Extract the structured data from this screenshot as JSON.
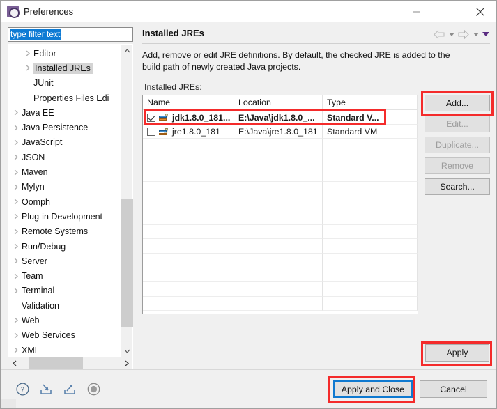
{
  "window": {
    "title": "Preferences",
    "icon": "preferences-gear-icon",
    "controls": {
      "minimize": "minimize-icon",
      "maximize": "maximize-icon",
      "close": "close-icon"
    }
  },
  "filter": {
    "value": "type filter text",
    "placeholder": "type filter text"
  },
  "tree": {
    "items": [
      {
        "label": "Editor",
        "depth": 1,
        "expandable": true,
        "selected": false
      },
      {
        "label": "Installed JREs",
        "depth": 1,
        "expandable": true,
        "selected": true
      },
      {
        "label": "JUnit",
        "depth": 1,
        "expandable": false,
        "selected": false
      },
      {
        "label": "Properties Files Edi",
        "depth": 1,
        "expandable": false,
        "selected": false
      },
      {
        "label": "Java EE",
        "depth": 0,
        "expandable": true,
        "selected": false
      },
      {
        "label": "Java Persistence",
        "depth": 0,
        "expandable": true,
        "selected": false
      },
      {
        "label": "JavaScript",
        "depth": 0,
        "expandable": true,
        "selected": false
      },
      {
        "label": "JSON",
        "depth": 0,
        "expandable": true,
        "selected": false
      },
      {
        "label": "Maven",
        "depth": 0,
        "expandable": true,
        "selected": false
      },
      {
        "label": "Mylyn",
        "depth": 0,
        "expandable": true,
        "selected": false
      },
      {
        "label": "Oomph",
        "depth": 0,
        "expandable": true,
        "selected": false
      },
      {
        "label": "Plug-in Development",
        "depth": 0,
        "expandable": true,
        "selected": false
      },
      {
        "label": "Remote Systems",
        "depth": 0,
        "expandable": true,
        "selected": false
      },
      {
        "label": "Run/Debug",
        "depth": 0,
        "expandable": true,
        "selected": false
      },
      {
        "label": "Server",
        "depth": 0,
        "expandable": true,
        "selected": false
      },
      {
        "label": "Team",
        "depth": 0,
        "expandable": true,
        "selected": false
      },
      {
        "label": "Terminal",
        "depth": 0,
        "expandable": true,
        "selected": false
      },
      {
        "label": "Validation",
        "depth": 0,
        "expandable": false,
        "selected": false
      },
      {
        "label": "Web",
        "depth": 0,
        "expandable": true,
        "selected": false
      },
      {
        "label": "Web Services",
        "depth": 0,
        "expandable": true,
        "selected": false
      },
      {
        "label": "XML",
        "depth": 0,
        "expandable": true,
        "selected": false
      }
    ]
  },
  "page": {
    "title": "Installed JREs",
    "description": "Add, remove or edit JRE definitions. By default, the checked JRE is added to the build path of newly created Java projects.",
    "table_label": "Installed JREs:",
    "nav": {
      "back": "back-arrow-icon",
      "back_menu": "back-dropdown-icon",
      "forward": "forward-arrow-icon",
      "forward_menu": "forward-dropdown-icon",
      "view_menu": "view-menu-icon"
    }
  },
  "table": {
    "columns": [
      "Name",
      "Location",
      "Type"
    ],
    "rows": [
      {
        "checked": true,
        "selected": true,
        "name": "jdk1.8.0_181...",
        "location": "E:\\Java\\jdk1.8.0_...",
        "type": "Standard V..."
      },
      {
        "checked": false,
        "selected": false,
        "name": "jre1.8.0_181",
        "location": "E:\\Java\\jre1.8.0_181",
        "type": "Standard VM"
      }
    ],
    "empty_row_count": 12
  },
  "side_buttons": [
    {
      "label": "Add...",
      "enabled": true,
      "highlighted": true
    },
    {
      "label": "Edit...",
      "enabled": false,
      "highlighted": false
    },
    {
      "label": "Duplicate...",
      "enabled": false,
      "highlighted": false
    },
    {
      "label": "Remove",
      "enabled": false,
      "highlighted": false
    },
    {
      "label": "Search...",
      "enabled": true,
      "highlighted": false
    }
  ],
  "apply_button": {
    "label": "Apply",
    "highlighted": true
  },
  "bottom": {
    "icons": [
      "help-icon",
      "import-icon",
      "export-icon",
      "record-icon"
    ],
    "apply_and_close": {
      "label": "Apply and Close",
      "focused": true,
      "highlighted": true
    },
    "cancel": {
      "label": "Cancel"
    }
  },
  "colors": {
    "annotation_red": "#f42b2b",
    "focus_blue": "#0f79d0",
    "selection_blue": "#0e7bd4",
    "title_icon_purple": "#7a5f96"
  }
}
